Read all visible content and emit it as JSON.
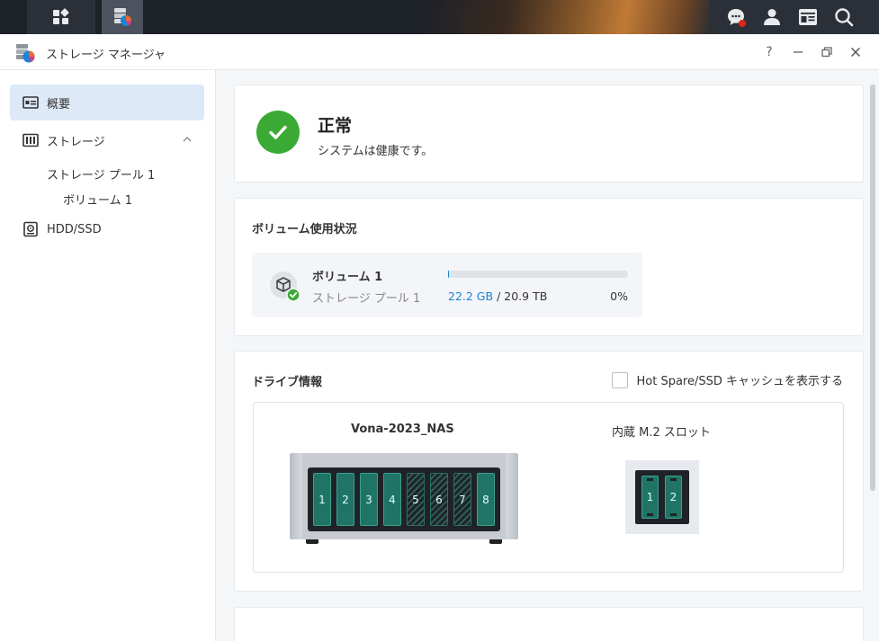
{
  "window": {
    "title": "ストレージ マネージャ"
  },
  "window_controls": {
    "help": "?",
    "minimize": "—",
    "restore": "🗗",
    "close": "✕"
  },
  "sidebar": {
    "items": [
      {
        "label": "概要",
        "icon": "overview-icon",
        "active": true
      },
      {
        "label": "ストレージ",
        "icon": "storage-icon",
        "expanded": true
      },
      {
        "label": "ストレージ プール 1",
        "level": 1
      },
      {
        "label": "ボリューム 1",
        "level": 2
      },
      {
        "label": "HDD/SSD",
        "icon": "hdd-icon"
      }
    ]
  },
  "status": {
    "title": "正常",
    "description": "システムは健康です。"
  },
  "volume_usage": {
    "title": "ボリューム使用状況",
    "volume_name": "ボリューム 1",
    "pool_name": "ストレージ プール 1",
    "used": "22.2 GB",
    "separator": "/",
    "total": "20.9 TB",
    "percent": "0%",
    "fill_fraction": 0.001
  },
  "drive_info": {
    "title": "ドライブ情報",
    "hot_spare_label": "Hot Spare/SSD キャッシュを表示する",
    "nas_name": "Vona-2023_NAS",
    "m2_label": "内蔵 M.2 スロット",
    "bays": [
      {
        "label": "1",
        "installed": true
      },
      {
        "label": "2",
        "installed": true
      },
      {
        "label": "3",
        "installed": true
      },
      {
        "label": "4",
        "installed": true
      },
      {
        "label": "5",
        "installed": false
      },
      {
        "label": "6",
        "installed": false
      },
      {
        "label": "7",
        "installed": false
      },
      {
        "label": "8",
        "installed": true
      }
    ],
    "m2_slots": [
      "1",
      "2"
    ]
  },
  "colors": {
    "accent": "#1a84d6",
    "status_ok": "#3aaa35",
    "drive": "#207465"
  }
}
